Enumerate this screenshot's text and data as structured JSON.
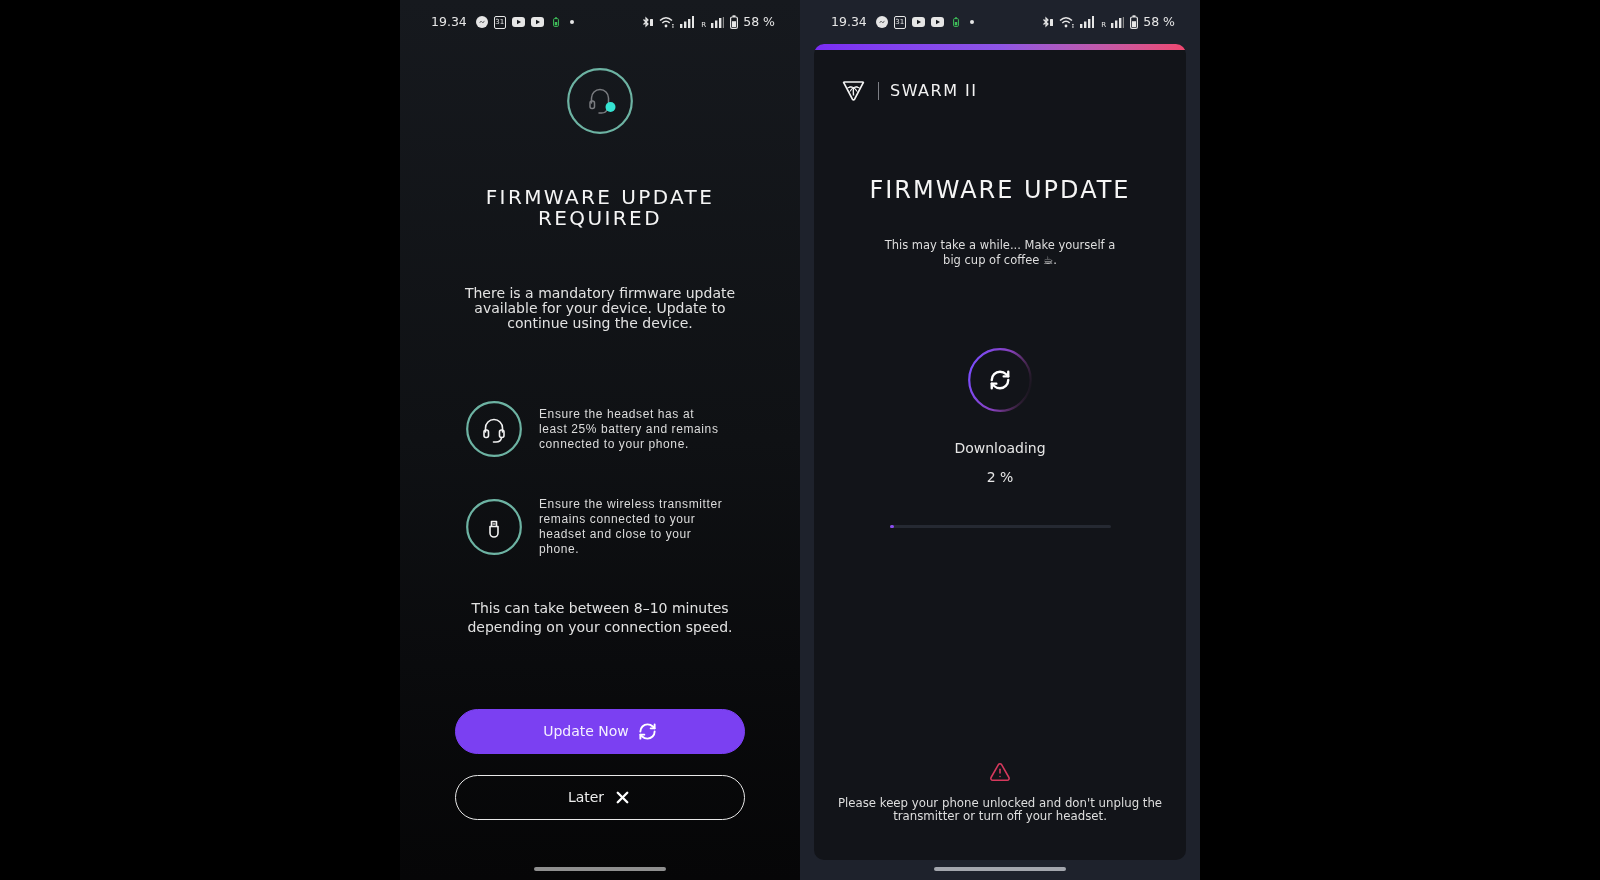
{
  "update_required_screen": {
    "status_bar": {
      "time": "19.34",
      "calendar_day": "31",
      "roaming_label": "R",
      "battery": "58 %"
    },
    "title": "FIRMWARE UPDATE REQUIRED",
    "message": "There is a mandatory firmware update available for your device. Update to continue using the device.",
    "requirements": [
      {
        "kind": "headset",
        "text": "Ensure the headset has at least 25% battery and remains connected to your phone."
      },
      {
        "kind": "transmitter",
        "text": "Ensure the wireless transmitter remains connected to your headset and close to your phone."
      }
    ],
    "duration_note": "This can take between 8–10 minutes depending on your connection speed.",
    "buttons": [
      {
        "kind": "primary",
        "label": "Update Now"
      },
      {
        "kind": "outline",
        "label": "Later"
      }
    ]
  },
  "progress_screen": {
    "status_bar": {
      "time": "19.34",
      "calendar_day": "31",
      "roaming_label": "R",
      "battery": "58 %"
    },
    "brand": "SWARM II",
    "title": "FIRMWARE UPDATE",
    "subtitle": "This may take a while... Make yourself a big cup of coffee ☕.",
    "status": "Downloading",
    "percent": "2 %",
    "progress": {
      "level": 0.02
    },
    "warning": "Please keep your phone unlocked and don't unplug the transmitter or turn off your headset."
  }
}
